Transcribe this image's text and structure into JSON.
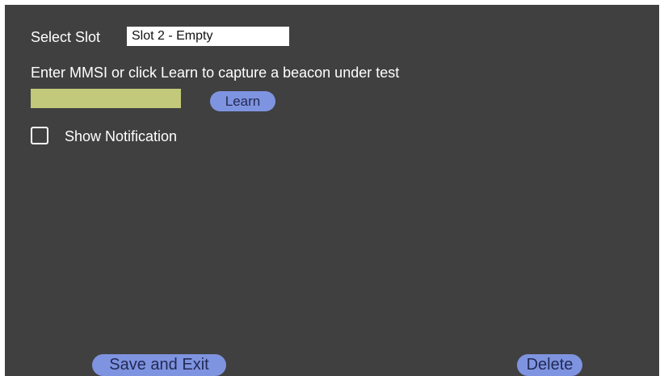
{
  "form": {
    "select_slot_label": "Select Slot",
    "slot_value": "Slot 2 - Empty",
    "instruction": "Enter MMSI or click Learn to capture  a beacon under test",
    "mmsi_value": "",
    "learn_label": "Learn",
    "show_notification_label": "Show Notification",
    "show_notification_checked": false
  },
  "footer": {
    "save_label": "Save and Exit",
    "delete_label": "Delete"
  },
  "colors": {
    "panel_background": "#404040",
    "input_background": "#c2c97a",
    "button_background": "#7f94e0"
  }
}
